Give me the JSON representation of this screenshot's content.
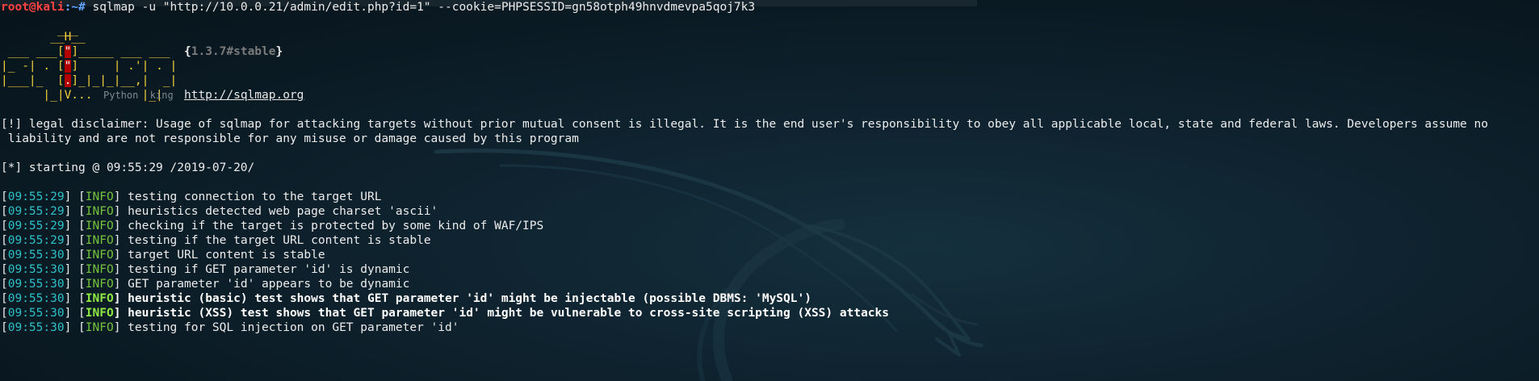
{
  "prompt": {
    "user_host": "root@kali",
    "path": ":~#",
    "command": " sqlmap -u \"http://10.0.0.21/admin/edit.php?id=1\" --cookie=PHPSESSID=gn58otph49hnvdmevpa5qoj7k3"
  },
  "banner": {
    "line1": "        ___",
    "line2": "       __H__",
    "line3a": " ___ ___[",
    "line3q": "\"",
    "line3b": "]_____ ___ ___  ",
    "version": "{1.3.7#stable}",
    "line4a": "|_ -| . [",
    "line4q": "\"",
    "line4b": "]     | .'| . |",
    "line5a": "|___|_  [",
    "line5q": ".",
    "line5b": "]_|_|_|__,|  _|",
    "line6": "      |_|V...       |_|   ",
    "ghost": "Python  king",
    "url": "http://sqlmap.org"
  },
  "disclaimer": {
    "line1": "[!] legal disclaimer: Usage of sqlmap for attacking targets without prior mutual consent is illegal. It is the end user's responsibility to obey all applicable local, state and federal laws. Developers assume no",
    "line2": " liability and are not responsible for any misuse or damage caused by this program"
  },
  "starting": "[*] starting @ 09:55:29 /2019-07-20/",
  "log": [
    {
      "time": "09:55:29",
      "level": "INFO",
      "msg": "testing connection to the target URL",
      "bold": false
    },
    {
      "time": "09:55:29",
      "level": "INFO",
      "msg": "heuristics detected web page charset 'ascii'",
      "bold": false
    },
    {
      "time": "09:55:29",
      "level": "INFO",
      "msg": "checking if the target is protected by some kind of WAF/IPS",
      "bold": false
    },
    {
      "time": "09:55:29",
      "level": "INFO",
      "msg": "testing if the target URL content is stable",
      "bold": false
    },
    {
      "time": "09:55:30",
      "level": "INFO",
      "msg": "target URL content is stable",
      "bold": false
    },
    {
      "time": "09:55:30",
      "level": "INFO",
      "msg": "testing if GET parameter 'id' is dynamic",
      "bold": false
    },
    {
      "time": "09:55:30",
      "level": "INFO",
      "msg": "GET parameter 'id' appears to be dynamic",
      "bold": false
    },
    {
      "time": "09:55:30",
      "level": "INFO",
      "msg": "heuristic (basic) test shows that GET parameter 'id' might be injectable (possible DBMS: 'MySQL')",
      "bold": true
    },
    {
      "time": "09:55:30",
      "level": "INFO",
      "msg": "heuristic (XSS) test shows that GET parameter 'id' might be vulnerable to cross-site scripting (XSS) attacks",
      "bold": true
    },
    {
      "time": "09:55:30",
      "level": "INFO",
      "msg": "testing for SQL injection on GET parameter 'id'",
      "bold": false
    }
  ],
  "colors": {
    "background": "#0f2430",
    "timestamp": "#2ec0c8",
    "info": "#74c33c",
    "prompt_user": "#ff4343",
    "banner": "#f3d13b"
  }
}
